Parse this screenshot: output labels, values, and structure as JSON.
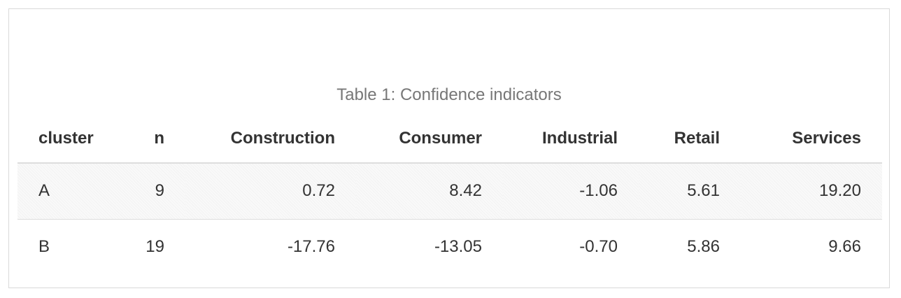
{
  "table": {
    "caption": "Table 1: Confidence indicators",
    "columns": [
      "cluster",
      "n",
      "Construction",
      "Consumer",
      "Industrial",
      "Retail",
      "Services"
    ],
    "rows": [
      [
        "A",
        "9",
        "0.72",
        "8.42",
        "-1.06",
        "5.61",
        "19.20"
      ],
      [
        "B",
        "19",
        "-17.76",
        "-13.05",
        "-0.70",
        "5.86",
        "9.66"
      ]
    ]
  }
}
